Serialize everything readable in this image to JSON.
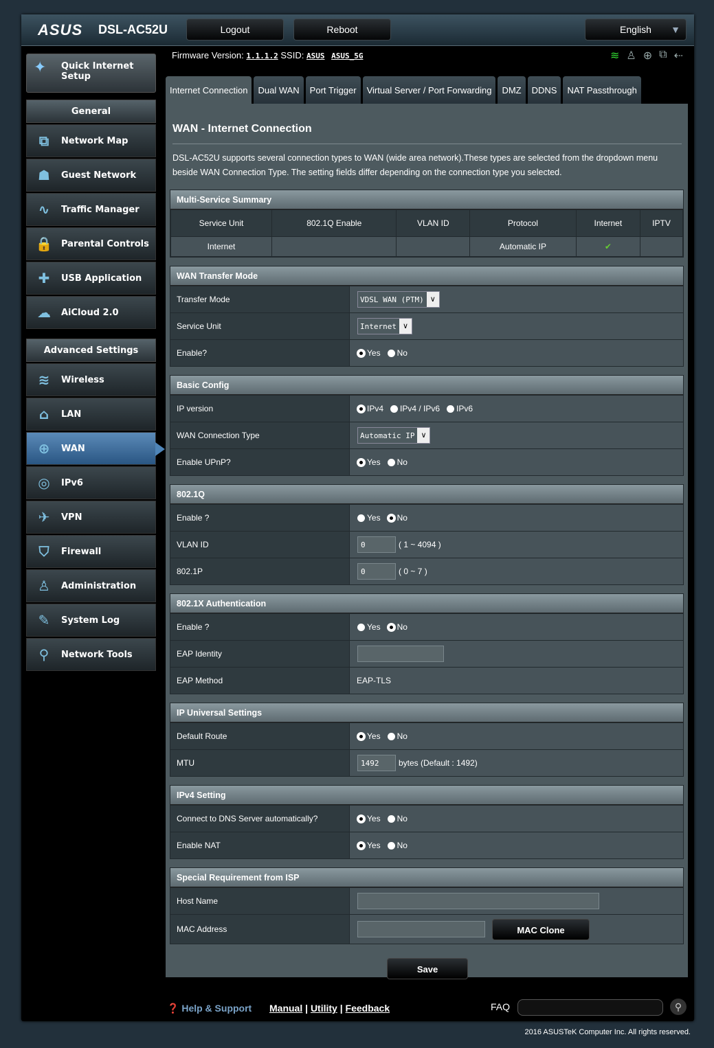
{
  "header": {
    "brand": "ASUS",
    "model": "DSL-AC52U",
    "logout": "Logout",
    "reboot": "Reboot",
    "language": "English"
  },
  "status": {
    "firmware_label": "Firmware Version:",
    "firmware": "1.1.1.2",
    "ssid_label": "SSID:",
    "ssid1": "ASUS",
    "ssid2": "ASUS_5G"
  },
  "sidebar": {
    "qis": "Quick Internet Setup",
    "general": "General",
    "general_items": [
      {
        "label": "Network Map",
        "icon": "network-map-icon",
        "g": "⧉"
      },
      {
        "label": "Guest Network",
        "icon": "guest-network-icon",
        "g": "☗"
      },
      {
        "label": "Traffic Manager",
        "icon": "traffic-manager-icon",
        "g": "∿"
      },
      {
        "label": "Parental Controls",
        "icon": "lock-icon",
        "g": "🔒"
      },
      {
        "label": "USB Application",
        "icon": "puzzle-icon",
        "g": "✚"
      },
      {
        "label": "AiCloud 2.0",
        "icon": "cloud-icon",
        "g": "☁"
      }
    ],
    "advanced": "Advanced Settings",
    "advanced_items": [
      {
        "label": "Wireless",
        "icon": "wifi-icon",
        "g": "≋"
      },
      {
        "label": "LAN",
        "icon": "home-icon",
        "g": "⌂"
      },
      {
        "label": "WAN",
        "icon": "globe-icon",
        "g": "⊕",
        "active": true
      },
      {
        "label": "IPv6",
        "icon": "ipv6-icon",
        "g": "◎"
      },
      {
        "label": "VPN",
        "icon": "vpn-icon",
        "g": "✈"
      },
      {
        "label": "Firewall",
        "icon": "shield-icon",
        "g": "⛉"
      },
      {
        "label": "Administration",
        "icon": "user-icon",
        "g": "♙"
      },
      {
        "label": "System Log",
        "icon": "log-icon",
        "g": "✎"
      },
      {
        "label": "Network Tools",
        "icon": "tools-icon",
        "g": "⚲"
      }
    ]
  },
  "tabs": [
    "Internet Connection",
    "Dual WAN",
    "Port Trigger",
    "Virtual Server / Port Forwarding",
    "DMZ",
    "DDNS",
    "NAT Passthrough"
  ],
  "page": {
    "title": "WAN - Internet Connection",
    "description": "DSL-AC52U supports several connection types to WAN (wide area network).These types are selected from the dropdown menu beside WAN Connection Type. The setting fields differ depending on the connection type you selected."
  },
  "summary": {
    "title": "Multi-Service Summary",
    "columns": [
      "Service Unit",
      "802.1Q Enable",
      "VLAN ID",
      "Protocol",
      "Internet",
      "IPTV"
    ],
    "row": [
      "Internet",
      "",
      "",
      "Automatic IP",
      "✔",
      ""
    ]
  },
  "sections": [
    {
      "title": "WAN Transfer Mode",
      "rows": [
        {
          "label": "Transfer Mode",
          "type": "select",
          "value": "VDSL WAN (PTM)"
        },
        {
          "label": "Service Unit",
          "type": "select",
          "value": "Internet"
        },
        {
          "label": "Enable?",
          "type": "radio",
          "options": [
            "Yes",
            "No"
          ],
          "selected": 0
        }
      ]
    },
    {
      "title": "Basic Config",
      "rows": [
        {
          "label": "IP version",
          "type": "radio",
          "options": [
            "IPv4",
            "IPv4 / IPv6",
            "IPv6"
          ],
          "selected": 0
        },
        {
          "label": "WAN Connection Type",
          "type": "select",
          "value": "Automatic IP"
        },
        {
          "label": "Enable UPnP?",
          "type": "radio",
          "options": [
            "Yes",
            "No"
          ],
          "selected": 0
        }
      ]
    },
    {
      "title": "802.1Q",
      "rows": [
        {
          "label": "Enable ?",
          "type": "radio",
          "options": [
            "Yes",
            "No"
          ],
          "selected": 1
        },
        {
          "label": "VLAN ID",
          "type": "input",
          "value": "0",
          "hint": "( 1 ~ 4094 )"
        },
        {
          "label": "802.1P",
          "type": "input",
          "value": "0",
          "hint": "( 0 ~ 7 )"
        }
      ]
    },
    {
      "title": "802.1X Authentication",
      "rows": [
        {
          "label": "Enable ?",
          "type": "radio",
          "options": [
            "Yes",
            "No"
          ],
          "selected": 1
        },
        {
          "label": "EAP Identity",
          "type": "input",
          "value": "",
          "w": 126
        },
        {
          "label": "EAP Method",
          "type": "text",
          "value": "EAP-TLS"
        }
      ]
    },
    {
      "title": "IP Universal Settings",
      "rows": [
        {
          "label": "Default Route",
          "type": "radio",
          "options": [
            "Yes",
            "No"
          ],
          "selected": 0
        },
        {
          "label": "MTU",
          "type": "input",
          "value": "1492",
          "hint": "bytes (Default : 1492)"
        }
      ]
    },
    {
      "title": "IPv4 Setting",
      "rows": [
        {
          "label": "Connect to DNS Server automatically?",
          "type": "radio",
          "options": [
            "Yes",
            "No"
          ],
          "selected": 0
        },
        {
          "label": "Enable NAT",
          "type": "radio",
          "options": [
            "Yes",
            "No"
          ],
          "selected": 0
        }
      ]
    },
    {
      "title": "Special Requirement from ISP",
      "rows": [
        {
          "label": "Host Name",
          "type": "input",
          "value": "",
          "w": 352
        },
        {
          "label": "MAC Address",
          "type": "input",
          "value": "",
          "w": 186,
          "button": "MAC Clone"
        }
      ]
    }
  ],
  "save": "Save",
  "footer": {
    "help": "Help & Support",
    "manual": "Manual",
    "utility": "Utility",
    "feedback": "Feedback",
    "faq": "FAQ",
    "copyright": "2016 ASUSTeK Computer Inc. All rights reserved."
  }
}
